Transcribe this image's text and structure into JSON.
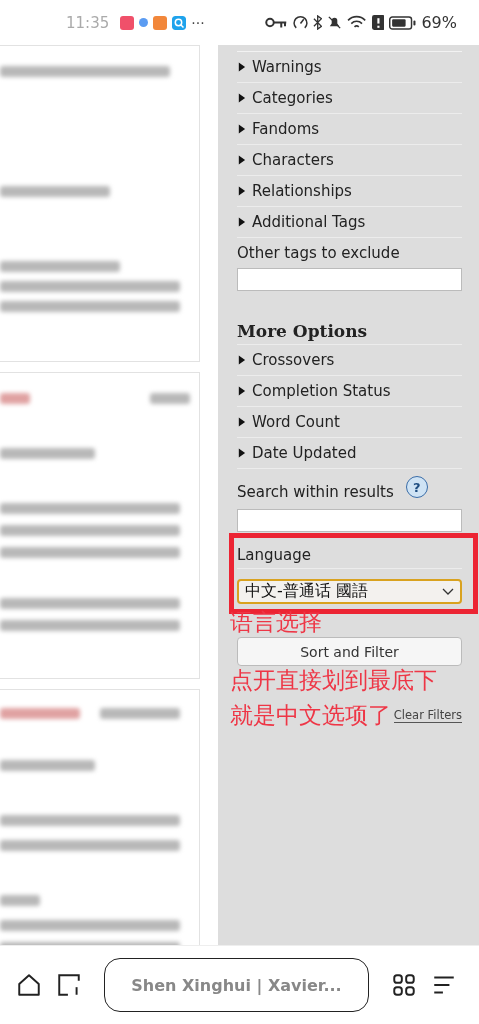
{
  "status_bar": {
    "time": "11:35",
    "more": "···",
    "battery": "69%"
  },
  "filters": {
    "tag_sections": [
      {
        "label": "Warnings",
        "expanded": false
      },
      {
        "label": "Categories",
        "expanded": false
      },
      {
        "label": "Fandoms",
        "expanded": false
      },
      {
        "label": "Characters",
        "expanded": false
      },
      {
        "label": "Relationships",
        "expanded": false
      },
      {
        "label": "Additional Tags",
        "expanded": false
      }
    ],
    "exclude_label": "Other tags to exclude",
    "more_heading": "More Options",
    "more_sections": [
      {
        "label": "Crossovers",
        "expanded": false
      },
      {
        "label": "Completion Status",
        "expanded": false
      },
      {
        "label": "Word Count",
        "expanded": false
      },
      {
        "label": "Date Updated",
        "expanded": false
      }
    ],
    "search_label": "Search within results",
    "help": "?",
    "language_label": "Language",
    "language_value": "中文-普通话 國語",
    "submit": "Sort and Filter",
    "clear": "Clear Filters"
  },
  "annotation": [
    "语言选择",
    "点开直接划到最底下",
    "就是中文选项了"
  ],
  "browser_bar": {
    "address": "Shen Xinghui | Xavier..."
  }
}
